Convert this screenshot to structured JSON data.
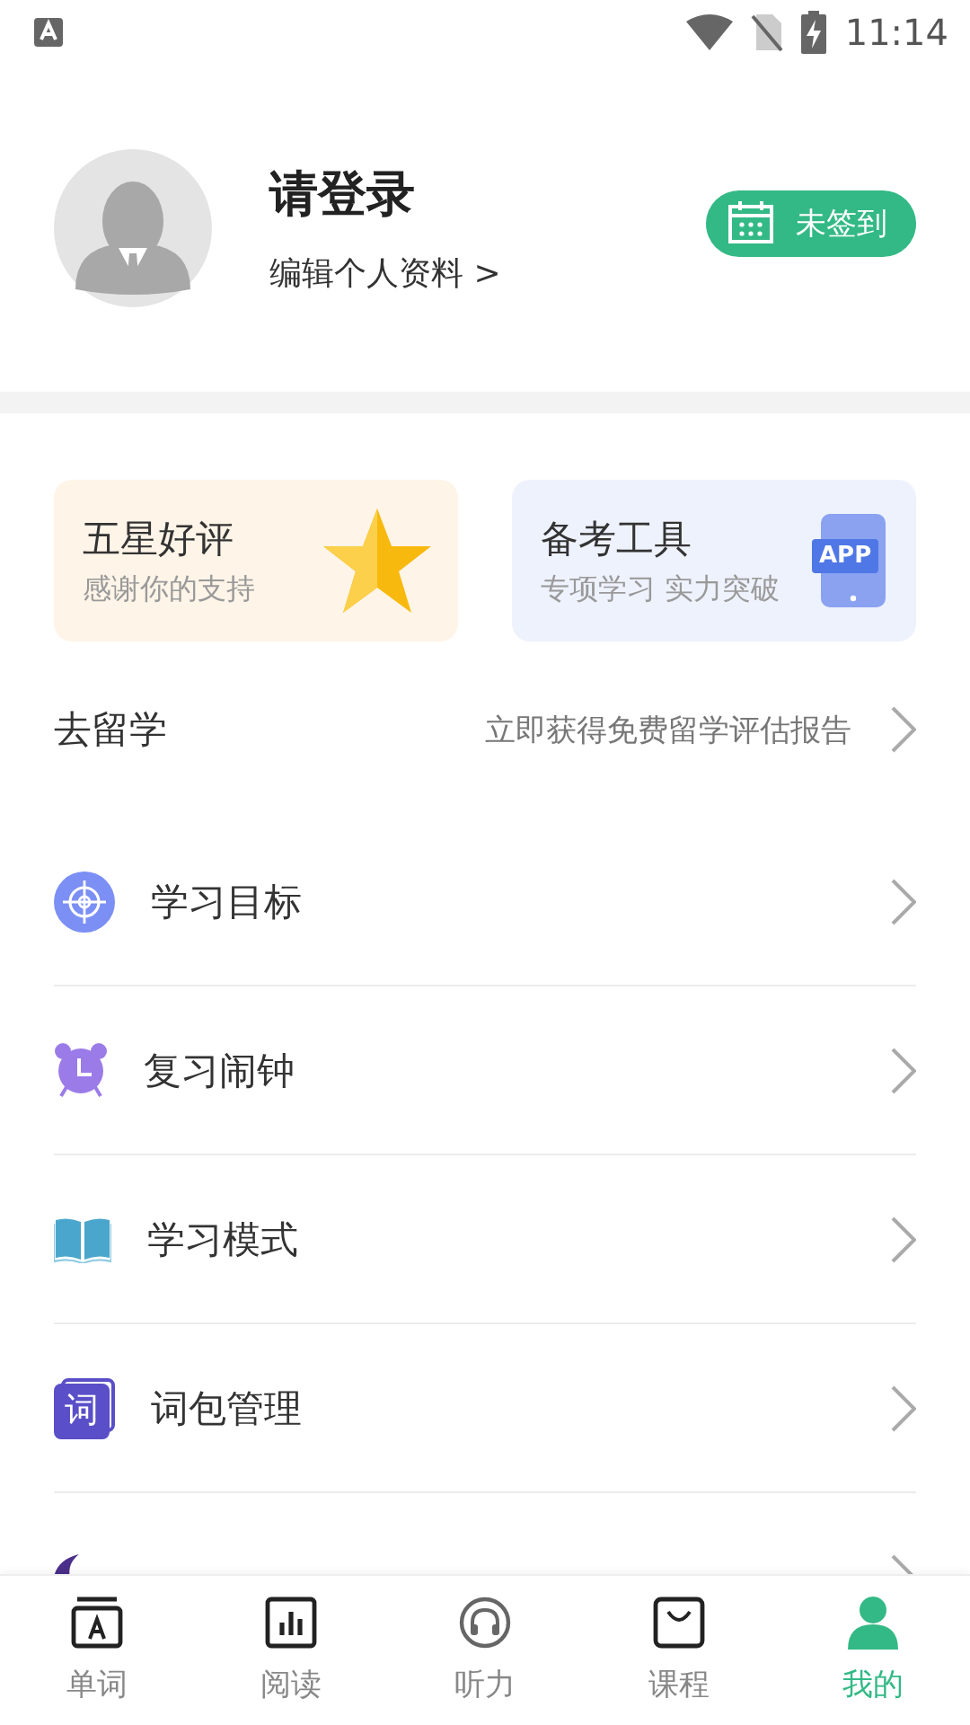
{
  "status_bar": {
    "time": "11:14"
  },
  "profile": {
    "name": "请登录",
    "edit_link": "编辑个人资料 >",
    "checkin": {
      "label": "未签到",
      "checked_in": false
    }
  },
  "cards": [
    {
      "kind": "star",
      "title": "五星好评",
      "subtitle": "感谢你的支持"
    },
    {
      "kind": "app",
      "title": "备考工具",
      "subtitle": "专项学习 实力突破",
      "badge": "APP"
    }
  ],
  "study_abroad": {
    "title": "去留学",
    "hint": "立即获得免费留学评估报告"
  },
  "menu": [
    {
      "kind": "target",
      "label": "学习目标"
    },
    {
      "kind": "alarm",
      "label": "复习闹钟"
    },
    {
      "kind": "book",
      "label": "学习模式"
    },
    {
      "kind": "wordbank",
      "label": "词包管理",
      "icon_text": "词"
    },
    {
      "kind": "moon"
    }
  ],
  "tabs": [
    {
      "kind": "word",
      "label": "单词",
      "selected": false
    },
    {
      "kind": "reading",
      "label": "阅读",
      "selected": false
    },
    {
      "kind": "listening",
      "label": "听力",
      "selected": false
    },
    {
      "kind": "course",
      "label": "课程",
      "selected": false
    },
    {
      "kind": "me",
      "label": "我的",
      "selected": true
    }
  ]
}
